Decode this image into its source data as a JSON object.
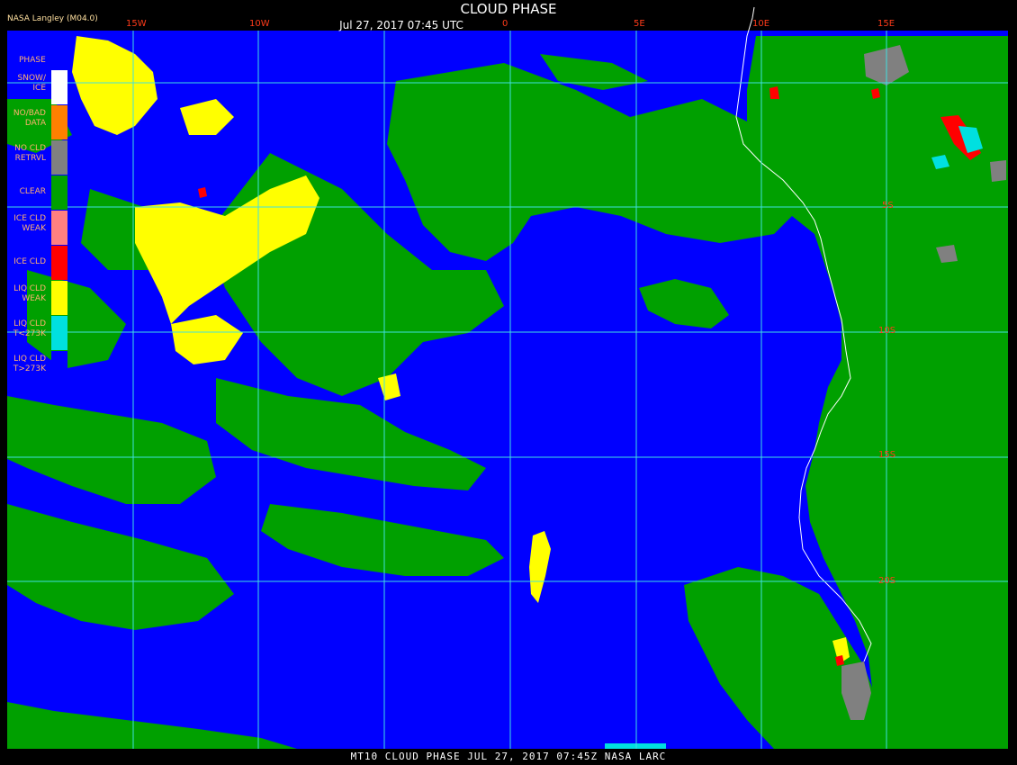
{
  "header": {
    "credit": "NASA Langley (M04.0)",
    "title": "CLOUD PHASE",
    "datetime": "Jul 27, 2017 07:45 UTC"
  },
  "legend": {
    "title": "PHASE",
    "items": [
      {
        "label": "SNOW/\nICE",
        "color": "#ffffff"
      },
      {
        "label": "NO/BAD\nDATA",
        "color": "#ff8000"
      },
      {
        "label": "NO CLD\nRETRVL",
        "color": "#808080"
      },
      {
        "label": "CLEAR",
        "color": "#00a000"
      },
      {
        "label": "ICE CLD\nWEAK",
        "color": "#ff8080"
      },
      {
        "label": "ICE CLD",
        "color": "#ff0000"
      },
      {
        "label": "LIQ CLD\nWEAK",
        "color": "#ffff00"
      },
      {
        "label": "LIQ CLD\nT<273K",
        "color": "#00e0e0"
      },
      {
        "label": "LIQ CLD\nT>273K",
        "color": "#0000ff"
      }
    ]
  },
  "grid": {
    "longitude_labels": [
      "15W",
      "10W",
      "0",
      "5E",
      "10E",
      "15E"
    ],
    "latitude_labels": [
      "5S",
      "10S",
      "15S",
      "20S"
    ]
  },
  "footer": {
    "text": "MT10  CLOUD PHASE  JUL 27, 2017 07:45Z  NASA LARC"
  },
  "colors": {
    "ocean_liquid_cloud": "#0000ff",
    "clear": "#00a000",
    "liquid_weak": "#ffff00",
    "ice": "#ff0000",
    "grid_lines": "#40e0e0",
    "coastline": "#ffffff",
    "no_retrieval": "#808080",
    "cold_liquid": "#00e0e0"
  }
}
